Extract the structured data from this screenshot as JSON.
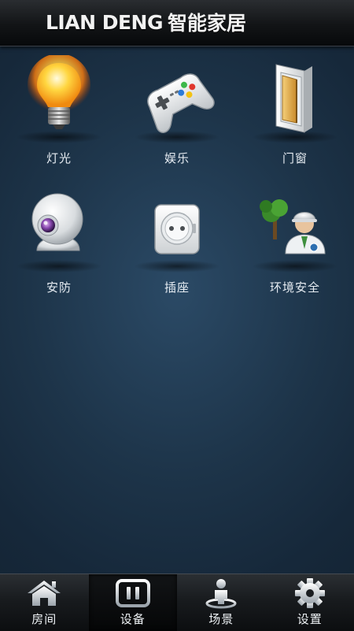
{
  "header": {
    "brand_latin": "LIAN DENG",
    "brand_cn": "智能家居"
  },
  "devices": [
    {
      "label": "灯光",
      "icon": "lightbulb-icon"
    },
    {
      "label": "娱乐",
      "icon": "gamepad-icon"
    },
    {
      "label": "门窗",
      "icon": "door-window-icon"
    },
    {
      "label": "安防",
      "icon": "security-camera-icon"
    },
    {
      "label": "插座",
      "icon": "power-socket-icon"
    },
    {
      "label": "环境安全",
      "icon": "environment-safety-icon"
    }
  ],
  "tabbar": {
    "tabs": [
      {
        "label": "房间",
        "icon": "house-icon",
        "active": false
      },
      {
        "label": "设备",
        "icon": "device-icon",
        "active": true
      },
      {
        "label": "场景",
        "icon": "scene-person-icon",
        "active": false
      },
      {
        "label": "设置",
        "icon": "gear-icon",
        "active": false
      }
    ]
  }
}
